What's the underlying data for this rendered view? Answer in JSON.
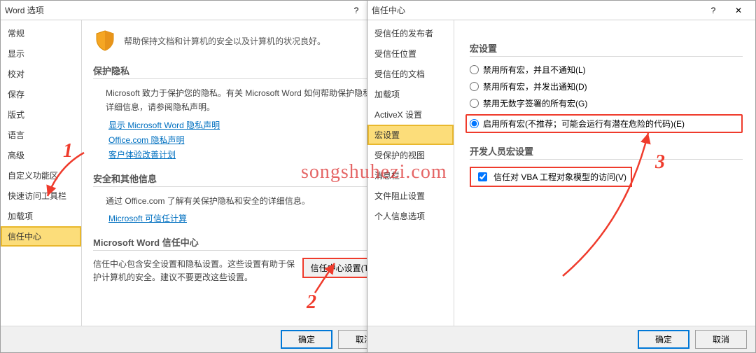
{
  "options_dialog": {
    "title": "Word 选项",
    "nav": [
      "常规",
      "显示",
      "校对",
      "保存",
      "版式",
      "语言",
      "高级",
      "自定义功能区",
      "快速访问工具栏",
      "加载项",
      "信任中心"
    ],
    "selected_nav_index": 10,
    "header_text": "帮助保持文档和计算机的安全以及计算机的状况良好。",
    "privacy_section_title": "保护隐私",
    "privacy_body": "Microsoft 致力于保护您的隐私。有关 Microsoft Word 如何帮助保护隐私的详细信息，请参阅隐私声明。",
    "privacy_links": [
      "显示 Microsoft Word 隐私声明",
      "Office.com 隐私声明",
      "客户体验改善计划"
    ],
    "security_section_title": "安全和其他信息",
    "security_body": "通过 Office.com 了解有关保护隐私和安全的详细信息。",
    "security_link": "Microsoft 可信任计算",
    "trust_center_section_title": "Microsoft Word 信任中心",
    "trust_center_body": "信任中心包含安全设置和隐私设置。这些设置有助于保护计算机的安全。建议不要更改这些设置。",
    "trust_center_button": "信任中心设置(T)...",
    "ok": "确定",
    "cancel": "取消"
  },
  "trust_dialog": {
    "title": "信任中心",
    "nav": [
      "受信任的发布者",
      "受信任位置",
      "受信任的文档",
      "加载项",
      "ActiveX 设置",
      "宏设置",
      "受保护的视图",
      "消息栏",
      "文件阻止设置",
      "个人信息选项"
    ],
    "selected_nav_index": 5,
    "macro_section_title": "宏设置",
    "macro_options": [
      "禁用所有宏，并且不通知(L)",
      "禁用所有宏，并发出通知(D)",
      "禁用无数字签署的所有宏(G)",
      "启用所有宏(不推荐；可能会运行有潜在危险的代码)(E)"
    ],
    "macro_selected_index": 3,
    "dev_macro_section_title": "开发人员宏设置",
    "vba_checkbox_label": "信任对 VBA 工程对象模型的访问(V)",
    "vba_checked": true,
    "ok": "确定",
    "cancel": "取消"
  },
  "markers": {
    "one": "1",
    "two": "2",
    "three": "3"
  },
  "watermark": "songshuhezi.com"
}
